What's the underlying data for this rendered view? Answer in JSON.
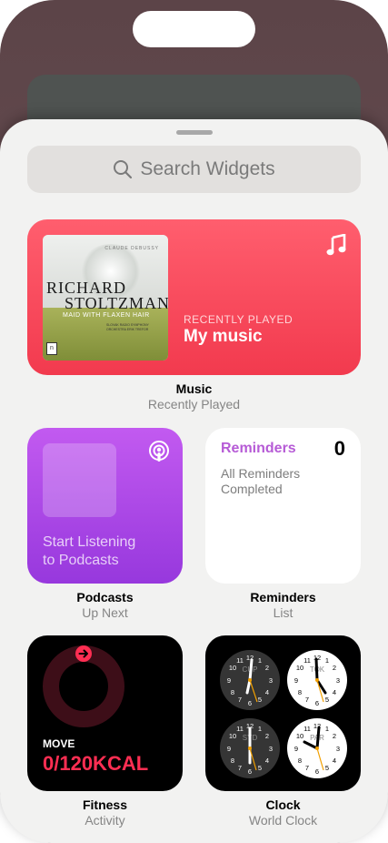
{
  "search": {
    "placeholder": "Search Widgets"
  },
  "music": {
    "album": {
      "composer": "CLAUDE DEBUSSY",
      "artist_line1": "RICHARD",
      "artist_line2": "STOLTZMAN",
      "title": "MAID WITH FLAXEN HAIR",
      "orchestra": "SLOVAK RADIO SYMPHONY ORCHESTRA ERIK TREFOR"
    },
    "small_label": "RECENTLY PLAYED",
    "big_label": "My music",
    "caption_title": "Music",
    "caption_subtitle": "Recently Played"
  },
  "podcasts": {
    "prompt_line1": "Start Listening",
    "prompt_line2": "to Podcasts",
    "caption_title": "Podcasts",
    "caption_subtitle": "Up Next"
  },
  "reminders": {
    "title": "Reminders",
    "count": "0",
    "message_line1": "All Reminders",
    "message_line2": "Completed",
    "caption_title": "Reminders",
    "caption_subtitle": "List"
  },
  "fitness": {
    "label": "MOVE",
    "value": "0/120KCAL",
    "progress": 0,
    "caption_title": "Fitness",
    "caption_subtitle": "Activity"
  },
  "clock": {
    "cities": [
      {
        "code": "CUP",
        "theme": "dark"
      },
      {
        "code": "TOK",
        "theme": "light"
      },
      {
        "code": "SYD",
        "theme": "dark"
      },
      {
        "code": "PAR",
        "theme": "light"
      }
    ],
    "caption_title": "Clock",
    "caption_subtitle": "World Clock"
  },
  "colors": {
    "music": "#f23a4e",
    "podcasts": "#9f3fe0",
    "reminders_accent": "#b65bd6",
    "fitness_move": "#ff2e52",
    "clock_second_hand": "#f2a000"
  }
}
